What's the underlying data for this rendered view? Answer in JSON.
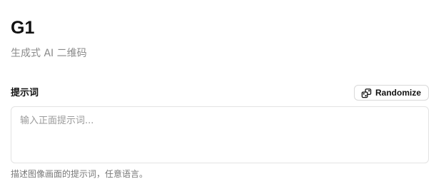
{
  "header": {
    "title": "G1",
    "subtitle": "生成式 AI 二维码"
  },
  "prompt": {
    "label": "提示词",
    "randomize_label": "Randomize",
    "randomize_icon": "dice-swap-icon",
    "placeholder": "输入正面提示词...",
    "value": "",
    "helper": "描述图像画面的提示词，任意语言。"
  }
}
